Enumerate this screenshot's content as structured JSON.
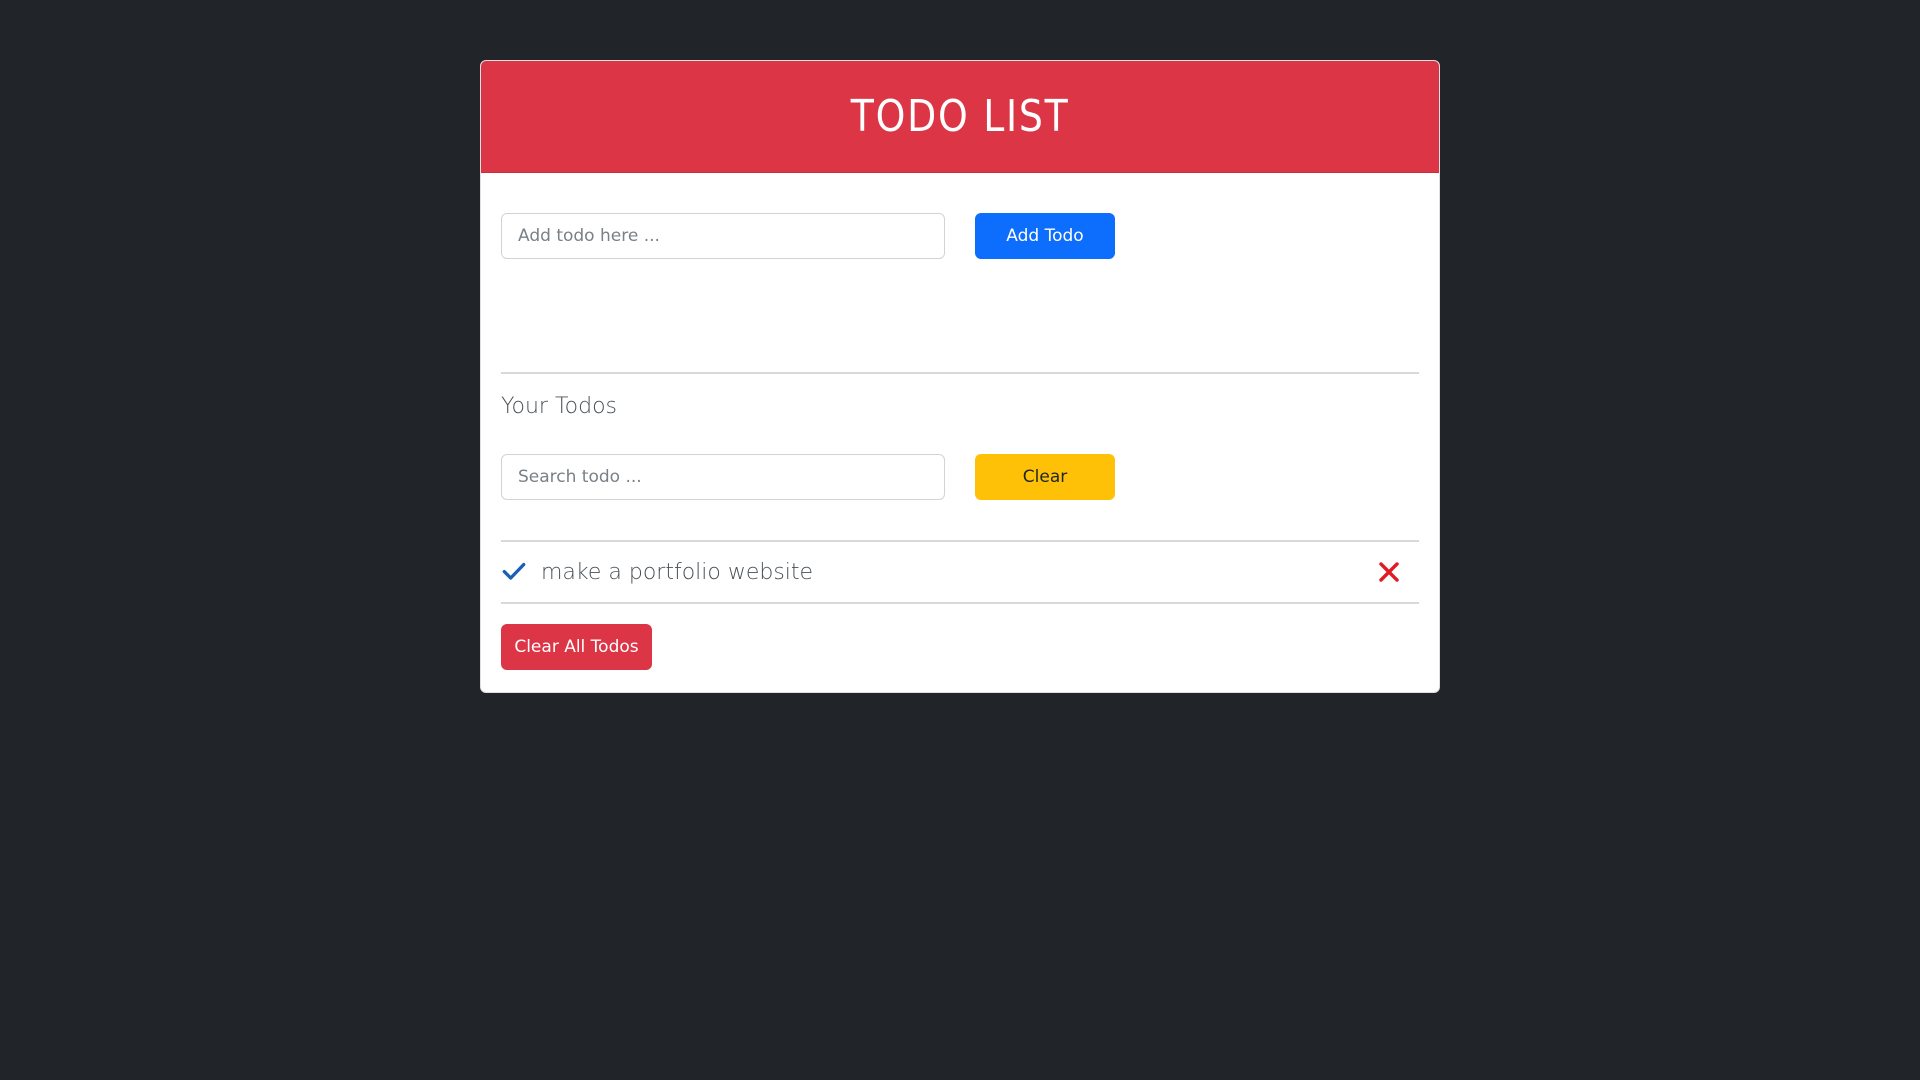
{
  "header": {
    "title": "TODO LIST"
  },
  "add_form": {
    "placeholder": "Add todo here ...",
    "button_label": "Add Todo"
  },
  "todos_section": {
    "title": "Your Todos",
    "search_placeholder": "Search todo  ...",
    "clear_button_label": "Clear"
  },
  "todos": [
    {
      "text": "make a portfolio website",
      "status_icon": "check-icon",
      "delete_icon": "close-icon"
    }
  ],
  "footer": {
    "clear_all_label": "Clear All Todos"
  },
  "colors": {
    "background": "#212529",
    "header": "#dc3545",
    "primary": "#0d6efd",
    "warning": "#ffc107",
    "danger": "#dc3545",
    "check": "#1a5fb4",
    "delete": "#e01b24"
  }
}
